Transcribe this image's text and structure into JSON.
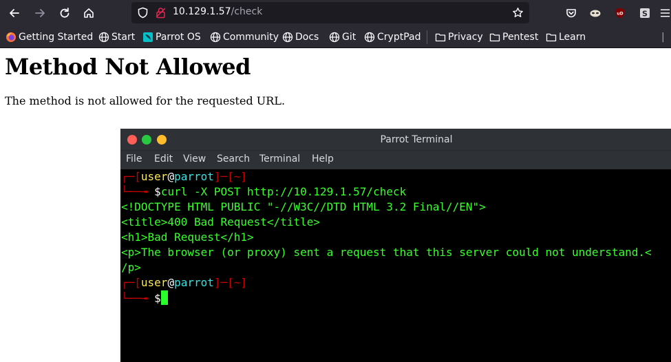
{
  "browser": {
    "url_host": "10.129.1.57",
    "url_path": "/check",
    "bookmarks": [
      {
        "label": "Getting Started",
        "icon": "firefox-icon"
      },
      {
        "label": "Start",
        "icon": "globe-icon"
      },
      {
        "label": "Parrot OS",
        "icon": "parrot-icon"
      },
      {
        "label": "Community",
        "icon": "globe-icon"
      },
      {
        "label": "Docs",
        "icon": "globe-icon"
      },
      {
        "label": "Git",
        "icon": "globe-icon"
      },
      {
        "label": "CryptPad",
        "icon": "globe-icon"
      },
      {
        "label": "Privacy",
        "icon": "folder-icon"
      },
      {
        "label": "Pentest",
        "icon": "folder-icon"
      },
      {
        "label": "Learn",
        "icon": "folder-icon"
      }
    ]
  },
  "page": {
    "heading": "Method Not Allowed",
    "message": "The method is not allowed for the requested URL."
  },
  "terminal": {
    "title": "Parrot Terminal",
    "menu": [
      "File",
      "Edit",
      "View",
      "Search",
      "Terminal",
      "Help"
    ],
    "prompt_user": "user",
    "prompt_at": "@",
    "prompt_host": "parrot",
    "prompt_dir": "~",
    "prompt_symbol": "$",
    "command": "curl -X POST http://10.129.1.57/check",
    "output": [
      "<!DOCTYPE HTML PUBLIC \"-//W3C//DTD HTML 3.2 Final//EN\">",
      "<title>400 Bad Request</title>",
      "<h1>Bad Request</h1>",
      "<p>The browser (or proxy) sent a request that this server could not understand.<",
      "/p>"
    ]
  },
  "colors": {
    "toolbar_bg": "#2b2a33",
    "terminal_green": "#38ff2c",
    "prompt_red": "#cc0000",
    "prompt_yellow": "#fce94f",
    "prompt_cyan": "#34e2e2"
  }
}
